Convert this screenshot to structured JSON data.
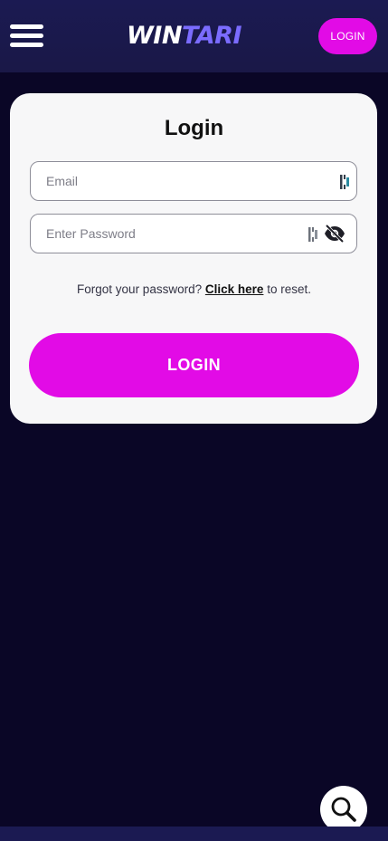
{
  "header": {
    "logo_part1": "WIN",
    "logo_part2": "TARI",
    "login_label": "LOGIN"
  },
  "form": {
    "title": "Login",
    "email_placeholder": "Email",
    "email_value": "",
    "password_placeholder": "Enter Password",
    "password_value": "",
    "forgot_prefix": "Forgot your password?",
    "forgot_link": "Click here",
    "forgot_suffix": "to reset.",
    "submit_label": "LOGIN"
  },
  "colors": {
    "background": "#0a0626",
    "header": "#1b1a52",
    "accent": "#e20be6",
    "card": "#f7f7f8"
  },
  "icons": {
    "menu": "hamburger-icon",
    "password_manager": "password-manager-icon",
    "visibility": "eye-slash-icon",
    "search": "search-icon"
  }
}
